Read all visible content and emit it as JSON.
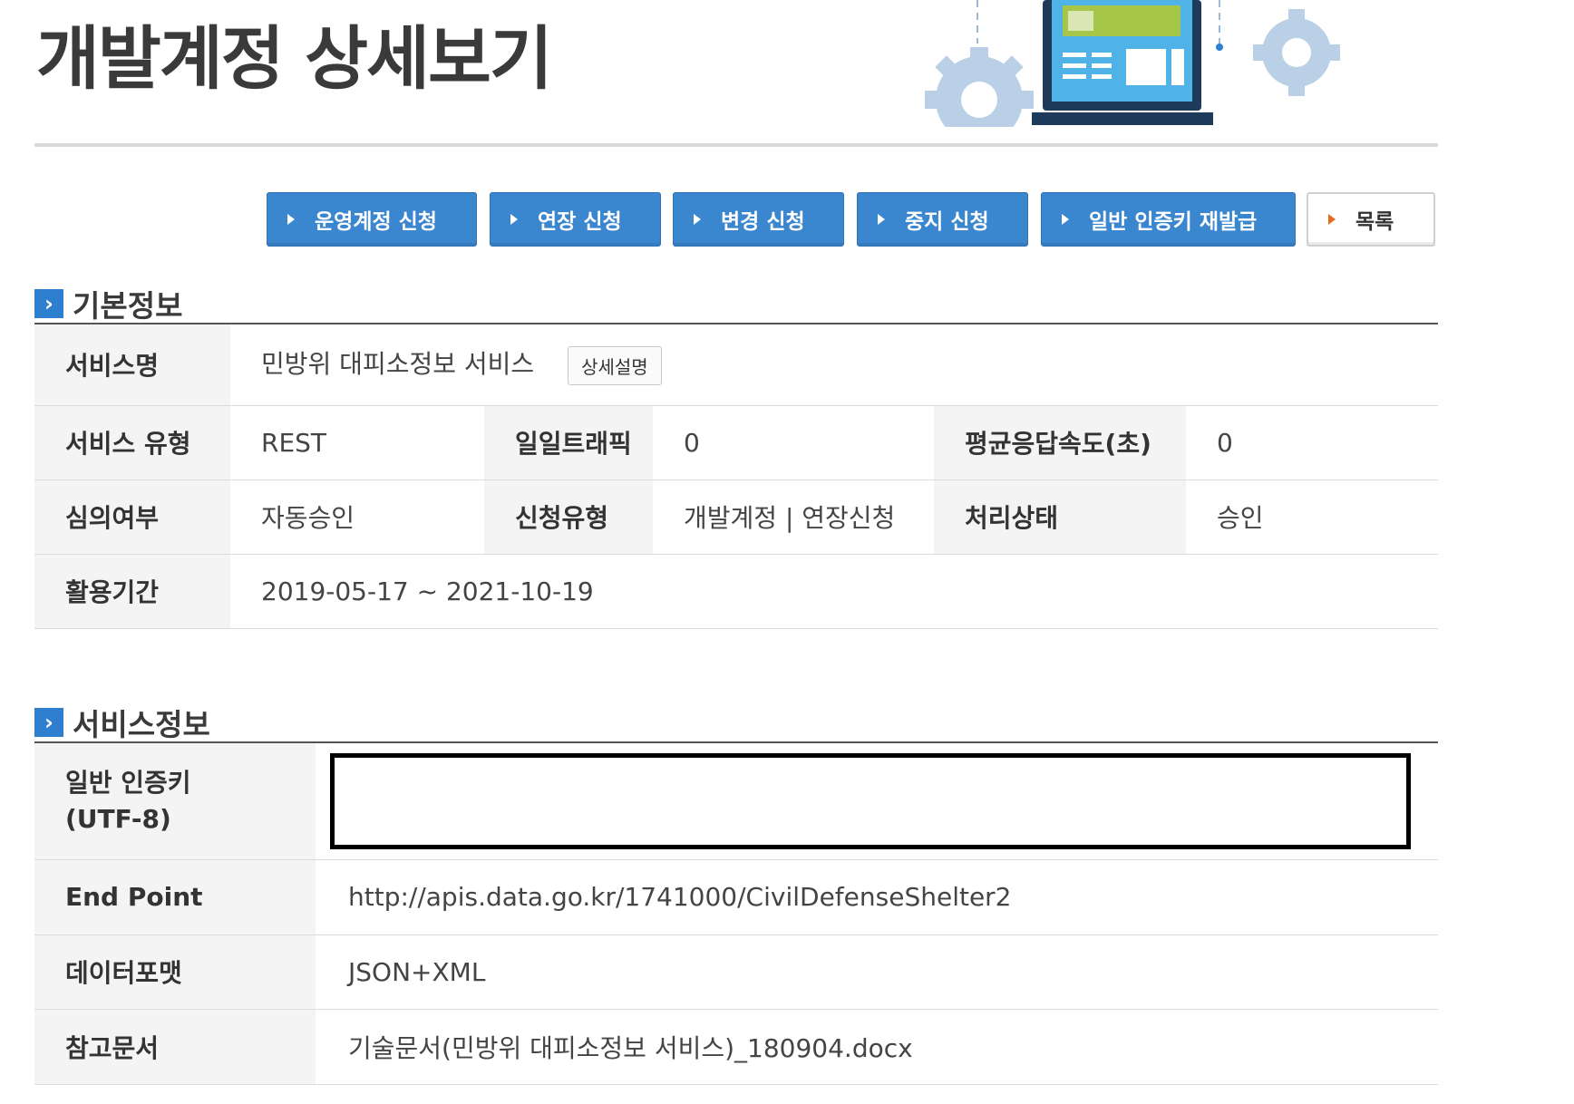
{
  "page": {
    "title": "개발계정 상세보기"
  },
  "actions": {
    "apply_prod": "운영계정 신청",
    "apply_extend": "연장 신청",
    "apply_change": "변경 신청",
    "apply_stop": "중지 신청",
    "reissue_key": "일반 인증키 재발급",
    "list": "목록"
  },
  "basic_info": {
    "heading": "기본정보",
    "service_name_label": "서비스명",
    "service_name": "민방위 대피소정보 서비스",
    "detail_button": "상세설명",
    "service_type_label": "서비스 유형",
    "service_type": "REST",
    "daily_traffic_label": "일일트래픽",
    "daily_traffic": "0",
    "avg_response_label": "평균응답속도(초)",
    "avg_response": "0",
    "review_label": "심의여부",
    "review": "자동승인",
    "request_type_label": "신청유형",
    "request_type": "개발계정 | 연장신청",
    "status_label": "처리상태",
    "status": "승인",
    "period_label": "활용기간",
    "period": "2019-05-17 ~ 2021-10-19"
  },
  "service_info": {
    "heading": "서비스정보",
    "key_label_line1": "일반 인증키",
    "key_label_line2": "(UTF-8)",
    "endpoint_label": "End Point",
    "endpoint": "http://apis.data.go.kr/1741000/CivilDefenseShelter2",
    "format_label": "데이터포맷",
    "format": "JSON+XML",
    "doc_label": "참고문서",
    "doc": "기술문서(민방위 대피소정보 서비스)_180904.docx"
  }
}
